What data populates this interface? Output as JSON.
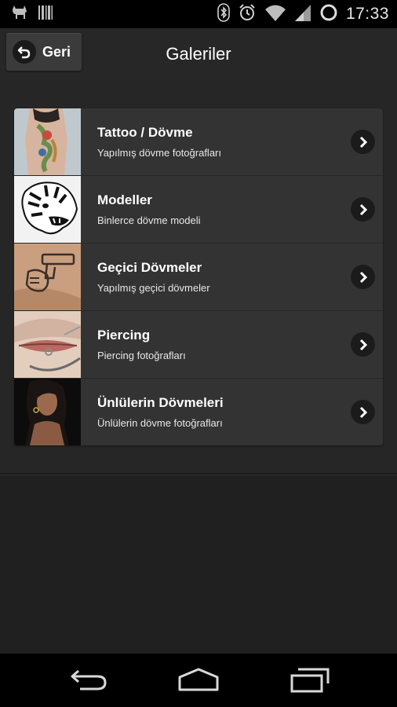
{
  "status_bar": {
    "time": "17:33"
  },
  "header": {
    "back_label": "Geri",
    "title": "Galeriler"
  },
  "galleries": [
    {
      "title": "Tattoo / Dövme",
      "subtitle": "Yapılmış dövme fotoğrafları"
    },
    {
      "title": "Modeller",
      "subtitle": "Binlerce dövme modeli"
    },
    {
      "title": "Geçici Dövmeler",
      "subtitle": "Yapılmış geçici dövmeler"
    },
    {
      "title": "Piercing",
      "subtitle": "Piercing fotoğrafları"
    },
    {
      "title": "Ünlülerin Dövmeleri",
      "subtitle": "Ünlülerin dövme fotoğrafları"
    }
  ]
}
